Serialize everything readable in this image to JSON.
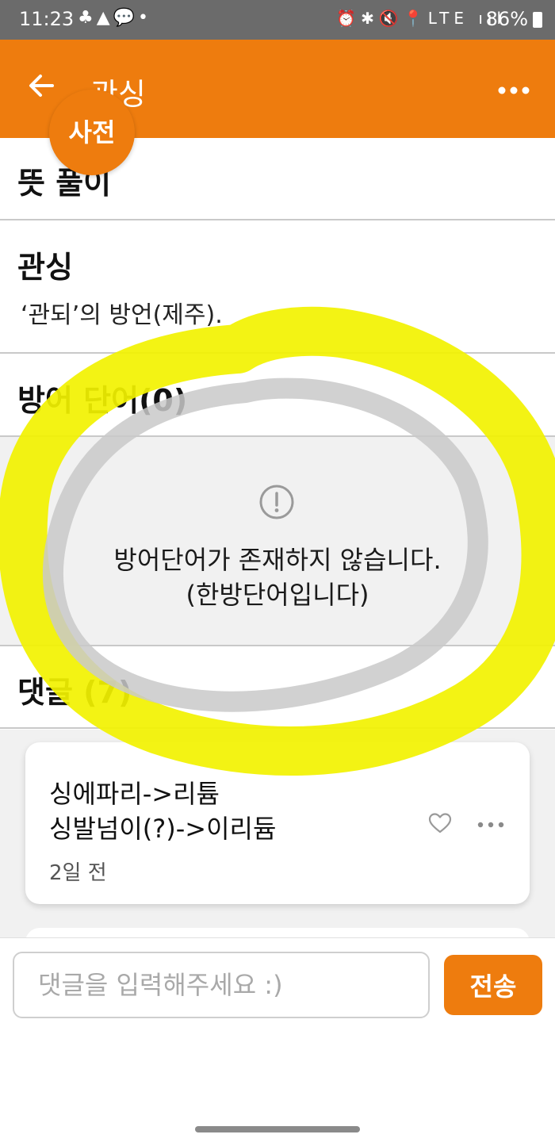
{
  "status_bar": {
    "time": "11:23",
    "left_icons": "♣▲💬•",
    "right_icons": "⏰✱🔇📍LTE ııl",
    "battery": "86%"
  },
  "app_bar": {
    "title": "관싱",
    "badge": "사전",
    "accent_color": "#ee7c0e"
  },
  "sections": {
    "meaning_header": "뜻 풀이",
    "word": "관싱",
    "definition": "‘관되’의 방언(제주).",
    "defense_header": "방어 단어(0)",
    "empty_message_line1": "방어단어가 존재하지 않습니다.",
    "empty_message_line2": "(한방단어입니다)",
    "comments_header": "댓글 (7)"
  },
  "comments": [
    {
      "line1": "싱에파리->리튬",
      "line2": "싱발넘이(?)->이리듐",
      "time": "2일 전"
    }
  ],
  "input": {
    "placeholder": "댓글을 입력해주세요 :)",
    "send_label": "전송"
  }
}
